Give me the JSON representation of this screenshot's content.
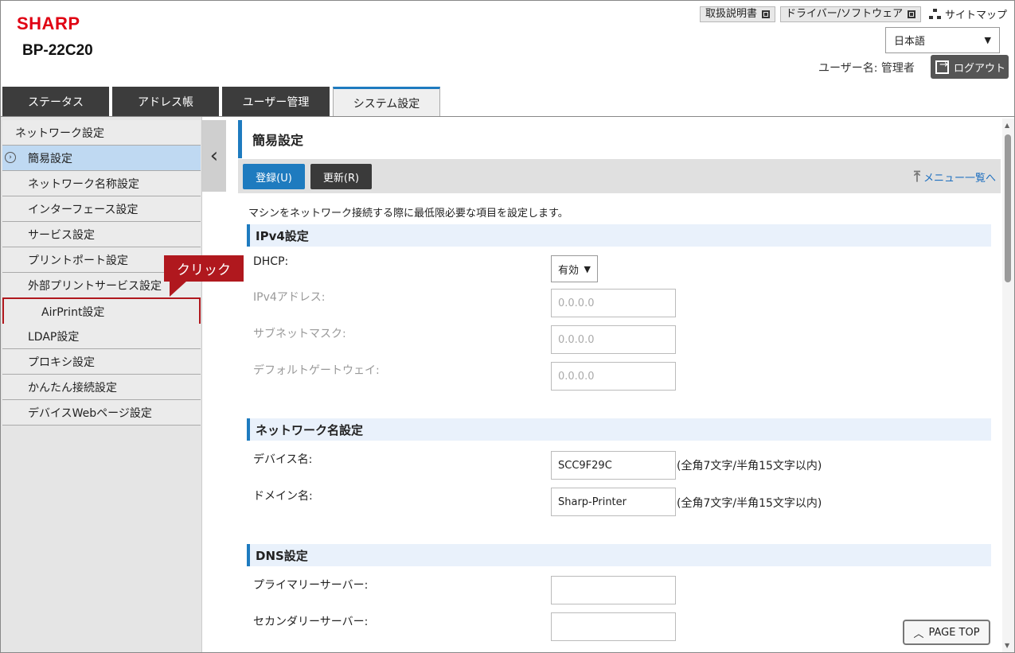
{
  "header": {
    "logo": "SHARP",
    "model": "BP-22C20",
    "manual_label": "取扱説明書",
    "driver_label": "ドライバー/ソフトウェア",
    "sitemap_label": "サイトマップ",
    "language": "日本語",
    "user_text": "ユーザー名: 管理者",
    "logout_label": "ログアウト"
  },
  "tabs": [
    {
      "label": "ステータス"
    },
    {
      "label": "アドレス帳"
    },
    {
      "label": "ユーザー管理"
    },
    {
      "label": "システム設定"
    }
  ],
  "sidebar": {
    "items": [
      {
        "label": "ネットワーク設定"
      },
      {
        "label": "簡易設定"
      },
      {
        "label": "ネットワーク名称設定"
      },
      {
        "label": "インターフェース設定"
      },
      {
        "label": "サービス設定"
      },
      {
        "label": "プリントポート設定"
      },
      {
        "label": "外部プリントサービス設定"
      },
      {
        "label": "AirPrint設定"
      },
      {
        "label": "LDAP設定"
      },
      {
        "label": "プロキシ設定"
      },
      {
        "label": "かんたん接続設定"
      },
      {
        "label": "デバイスWebページ設定"
      }
    ],
    "callout": "クリック"
  },
  "main": {
    "title": "簡易設定",
    "register_label": "登録(U)",
    "update_label": "更新(R)",
    "menu_list_label": "メニュー一覧へ",
    "description": "マシンをネットワーク接続する際に最低限必要な項目を設定します。",
    "ipv4": {
      "heading": "IPv4設定",
      "dhcp_label": "DHCP:",
      "dhcp_value": "有効",
      "ip_label": "IPv4アドレス:",
      "ip_value": "0.0.0.0",
      "subnet_label": "サブネットマスク:",
      "subnet_value": "0.0.0.0",
      "gateway_label": "デフォルトゲートウェイ:",
      "gateway_value": "0.0.0.0"
    },
    "network_name": {
      "heading": "ネットワーク名設定",
      "device_label": "デバイス名:",
      "device_value": "SCC9F29C",
      "device_hint": "(全角7文字/半角15文字以内)",
      "domain_label": "ドメイン名:",
      "domain_value": "Sharp-Printer",
      "domain_hint": "(全角7文字/半角15文字以内)"
    },
    "dns": {
      "heading": "DNS設定",
      "primary_label": "プライマリーサーバー:",
      "primary_value": "",
      "secondary_label": "セカンダリーサーバー:",
      "secondary_value": ""
    }
  },
  "pagetop_label": "PAGE TOP",
  "colors": {
    "brand_red": "#e00012",
    "accent_blue": "#1e7bbf",
    "callout_red": "#b0181e"
  }
}
